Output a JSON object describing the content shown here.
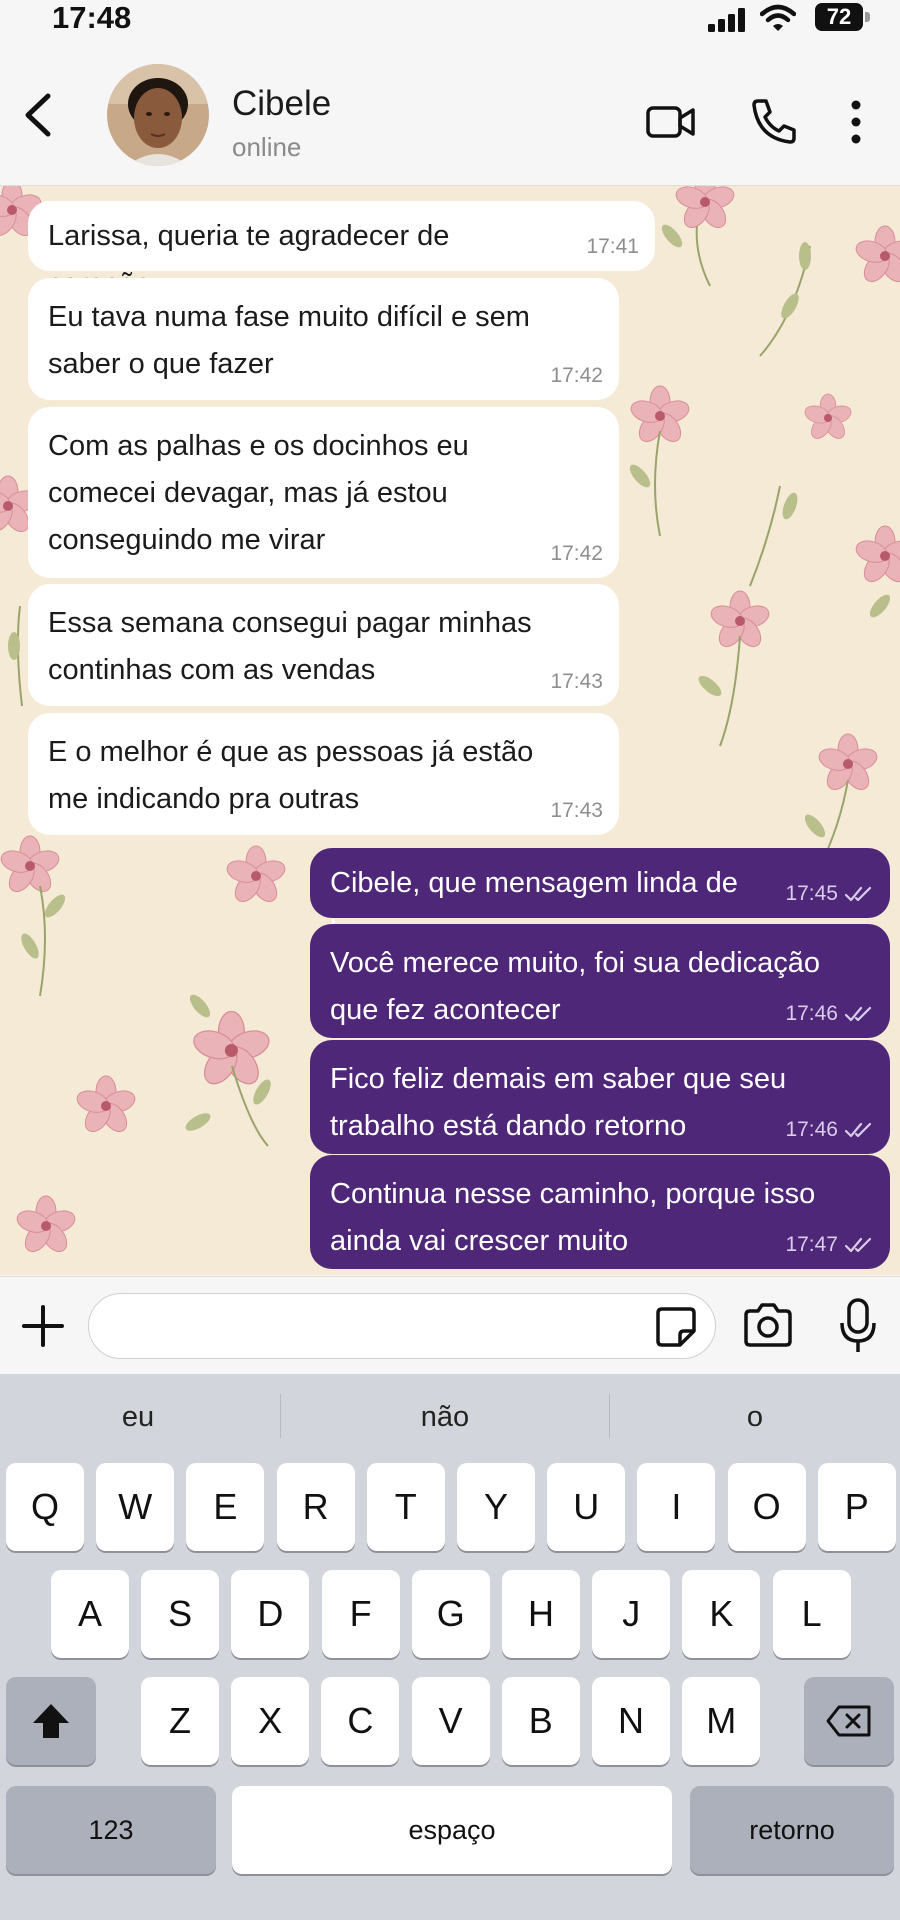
{
  "status_bar": {
    "time": "17:48",
    "battery": "72"
  },
  "header": {
    "contact_name": "Cibele",
    "contact_status": "online"
  },
  "messages": [
    {
      "dir": "in",
      "text": "Larissa, queria te agradecer de coração",
      "time": "17:41"
    },
    {
      "dir": "in",
      "text": "Eu tava numa fase muito difícil e sem saber o que fazer",
      "time": "17:42"
    },
    {
      "dir": "in",
      "text": "Com as palhas e os docinhos eu comecei devagar, mas já estou conseguindo me virar",
      "time": "17:42"
    },
    {
      "dir": "in",
      "text": "Essa semana consegui pagar minhas continhas com as vendas",
      "time": "17:43"
    },
    {
      "dir": "in",
      "text": "E o melhor é que as pessoas já estão me indicando pra outras",
      "time": "17:43"
    },
    {
      "dir": "out",
      "text": "Cibele, que mensagem linda de ler",
      "time": "17:45"
    },
    {
      "dir": "out",
      "text": "Você merece muito, foi sua dedicação que fez acontecer",
      "time": "17:46"
    },
    {
      "dir": "out",
      "text": "Fico feliz demais em saber que seu trabalho está dando retorno",
      "time": "17:46"
    },
    {
      "dir": "out",
      "text": "Continua nesse caminho, porque isso ainda vai crescer muito",
      "time": "17:47"
    }
  ],
  "input": {
    "value": "",
    "placeholder": ""
  },
  "keyboard": {
    "suggestions": [
      "eu",
      "não",
      "o"
    ],
    "row1": [
      "Q",
      "W",
      "E",
      "R",
      "T",
      "Y",
      "U",
      "I",
      "O",
      "P"
    ],
    "row2": [
      "A",
      "S",
      "D",
      "F",
      "G",
      "H",
      "J",
      "K",
      "L"
    ],
    "row3": [
      "Z",
      "X",
      "C",
      "V",
      "B",
      "N",
      "M"
    ],
    "numbers_key": "123",
    "space_key": "espaço",
    "return_key": "retorno"
  },
  "colors": {
    "outgoing_bubble": "#4e2778",
    "incoming_bubble": "#ffffff",
    "chat_background": "#f4ead6"
  },
  "icons": [
    "back-icon",
    "video-call-icon",
    "phone-icon",
    "more-icon",
    "plus-icon",
    "sticker-icon",
    "camera-icon",
    "mic-icon",
    "shift-icon",
    "backspace-icon",
    "double-check-icon"
  ]
}
